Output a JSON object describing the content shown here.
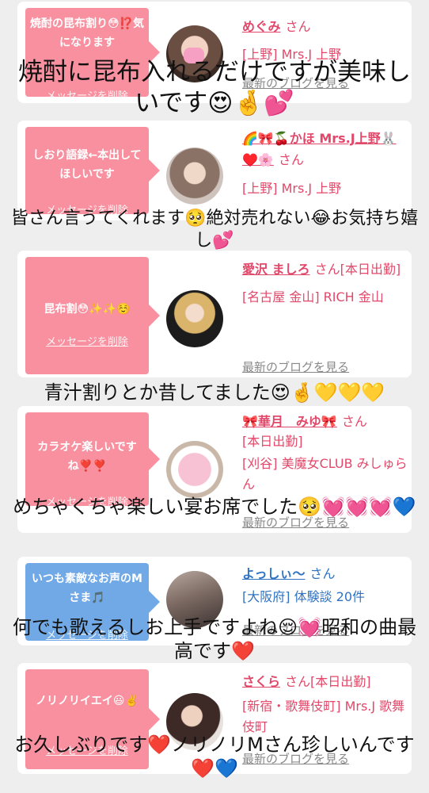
{
  "cards": [
    {
      "bubble": "焼酎の昆布割り😳⁉️気になります",
      "delete": "メッセージを削除",
      "name": "めぐみ",
      "san": "さん",
      "rows": [
        "[上野] Mrs.J 上野"
      ],
      "blog": "最新のブログを見る",
      "overlay": "焼酎に昆布入れるだけですが美味しいです😍🤞💕"
    },
    {
      "bubble": "しおり語録←本出してほしいです",
      "delete": "メッセージを削除",
      "name": "🌈🎀🍒かほ Mrs.J上野🐰♥️🌸",
      "san": "さん",
      "rows": [
        "[上野] Mrs.J 上野"
      ],
      "blog": "",
      "overlay": "皆さん言うてくれます🥺絶対売れない😂お気持ち嬉し💕"
    },
    {
      "bubble": "昆布割😳✨✨☺️",
      "delete": "メッセージを削除",
      "name": "愛沢 ましろ",
      "san": "さん[本日出勤]",
      "rows": [
        "[名古屋 金山] RICH 金山"
      ],
      "blog": "最新のブログを見る",
      "overlay": "青汁割りとか昔してました😍🤞💛💛💛"
    },
    {
      "bubble": "カラオケ楽しいですね❣️❣️",
      "delete": "メッセージを削除",
      "name": "🎀華月　みゆ🎀",
      "san": "さん",
      "rows": [
        "[本日出勤]",
        "[刈谷] 美魔女CLUB みしゅらん"
      ],
      "blog": "最新のブログを見る",
      "overlay": "めちゃくちゃ楽しい宴お席でした🥺💓💓💓💙"
    },
    {
      "bubble": "いつも素敵なお声のMさま🎵",
      "delete": "メッセージを削除",
      "name": "よっしぃ〜",
      "san": "さん",
      "rows": [
        "[大阪府] 体験談 20件"
      ],
      "blog": "最新のブログを見る",
      "overlay": "何でも歌えるしお上手ですよね😌💓昭和の曲最高です❤️"
    },
    {
      "bubble": "ノリノリイエイ😃✌️",
      "delete": "メッセージを削除",
      "name": "さくら",
      "san": "さん[本日出勤]",
      "rows": [
        "[新宿・歌舞伎町] Mrs.J 歌舞伎町"
      ],
      "blog": "最新のブログを見る",
      "overlay": "お久しぶりです❤️ノリノリMさん珍しいんです❤️💙"
    }
  ],
  "colors": {
    "pink": "#f8909f",
    "blue": "#71a9e6",
    "name_pink": "#e2486a",
    "name_blue": "#2f73c2"
  }
}
